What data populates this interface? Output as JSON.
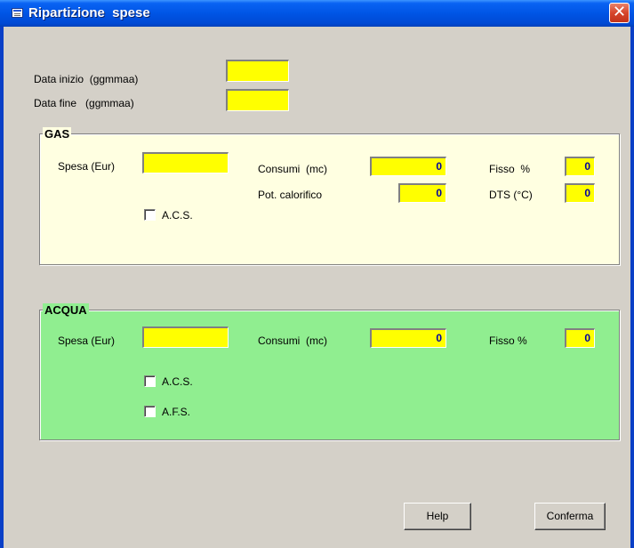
{
  "window": {
    "title": "Ripartizione  spese",
    "close_glyph": "✕",
    "title_icon": "window-icon"
  },
  "dates": {
    "start_label": "Data inizio  (ggmmaa)",
    "start_value": "",
    "end_label": "Data fine   (ggmmaa)",
    "end_value": ""
  },
  "gas": {
    "title": "GAS",
    "background": "#ffffe1",
    "spesa_label": "Spesa (Eur)",
    "spesa_value": "",
    "consumi_label": "Consumi  (mc)",
    "consumi_value": "0",
    "pot_label": "Pot. calorifico",
    "pot_value": "0",
    "fisso_label": "Fisso  %",
    "fisso_value": "0",
    "dts_label": "DTS (°C)",
    "dts_value": "0",
    "acs_label": "A.C.S.",
    "acs_checked": false
  },
  "acqua": {
    "title": "ACQUA",
    "background": "#90ee90",
    "spesa_label": "Spesa (Eur)",
    "spesa_value": "",
    "consumi_label": "Consumi  (mc)",
    "consumi_value": "0",
    "fisso_label": "Fisso %",
    "fisso_value": "0",
    "acs_label": "A.C.S.",
    "acs_checked": false,
    "afs_label": "A.F.S.",
    "afs_checked": false
  },
  "buttons": {
    "help_label": "Help",
    "confirm_label": "Conferma"
  },
  "colors": {
    "field_bg": "#ffff00",
    "value_text": "#0000a0",
    "dialog_bg": "#d4d0c8"
  }
}
